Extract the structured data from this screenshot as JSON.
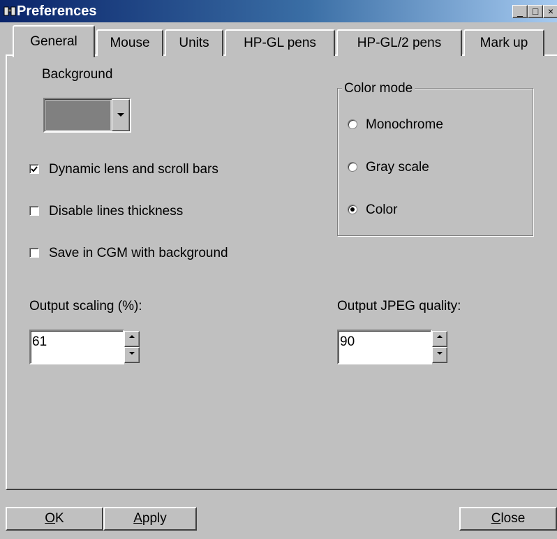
{
  "window": {
    "title": "Preferences",
    "controls": {
      "minimize": "_",
      "maximize": "□",
      "close": "×"
    }
  },
  "tabs": [
    {
      "label": "General",
      "selected": true
    },
    {
      "label": "Mouse",
      "selected": false
    },
    {
      "label": "Units",
      "selected": false
    },
    {
      "label": "HP-GL pens",
      "selected": false
    },
    {
      "label": "HP-GL/2 pens",
      "selected": false
    },
    {
      "label": "Mark up",
      "selected": false
    }
  ],
  "general": {
    "background_label": "Background",
    "background_color": "#808080",
    "options": [
      {
        "label": "Dynamic lens and scroll bars",
        "checked": true
      },
      {
        "label": "Disable lines thickness",
        "checked": false
      },
      {
        "label": "Save in CGM with background",
        "checked": false
      }
    ],
    "color_mode": {
      "title": "Color mode",
      "choices": [
        {
          "label": "Monochrome",
          "selected": false
        },
        {
          "label": "Gray scale",
          "selected": false
        },
        {
          "label": "Color",
          "selected": true
        }
      ]
    },
    "output_scaling": {
      "label": "Output scaling (%):",
      "value": "61"
    },
    "jpeg_quality": {
      "label": "Output JPEG quality:",
      "value": "90"
    }
  },
  "buttons": {
    "ok": {
      "mnemonic": "O",
      "rest": "K"
    },
    "apply": {
      "mnemonic": "A",
      "rest": "pply"
    },
    "close": {
      "mnemonic": "C",
      "rest": "lose"
    }
  }
}
